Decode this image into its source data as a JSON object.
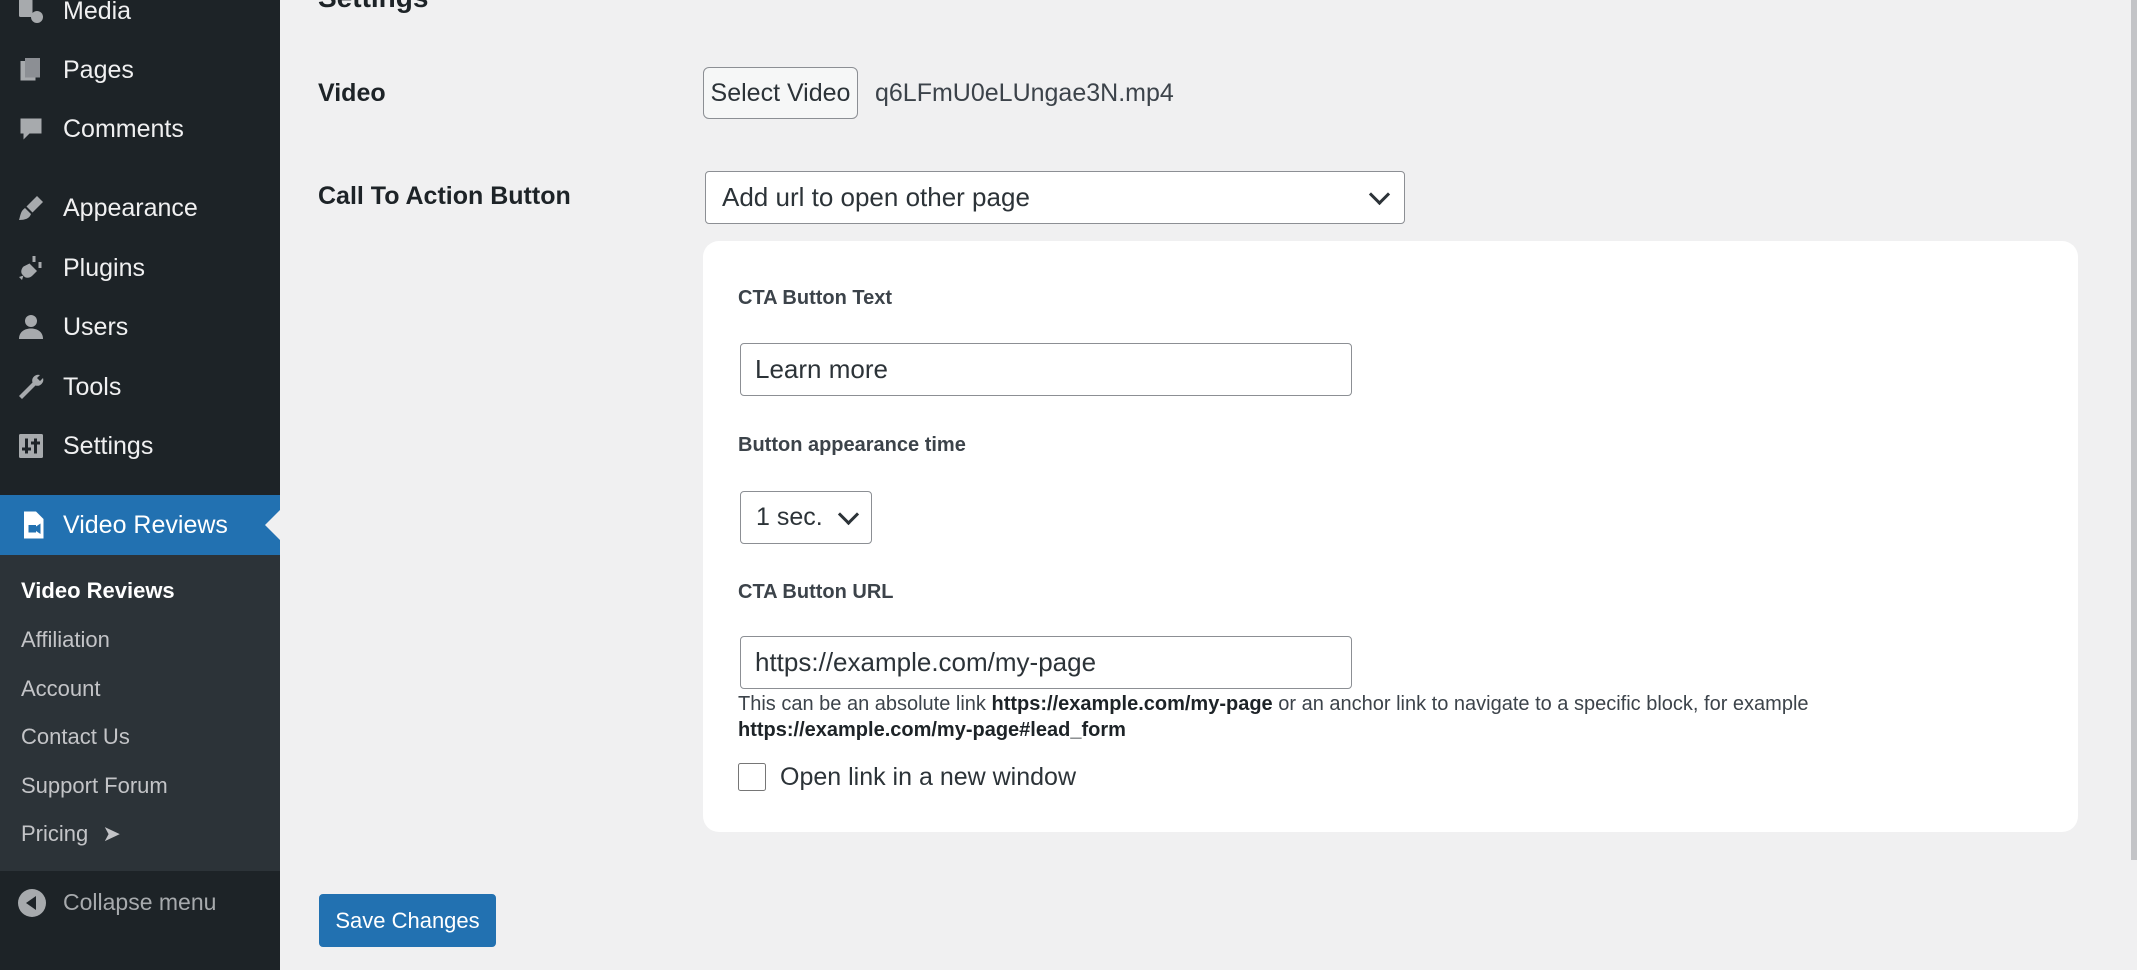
{
  "sidebar": {
    "items": [
      {
        "label": "Media",
        "icon": "media-icon"
      },
      {
        "label": "Pages",
        "icon": "pages-icon"
      },
      {
        "label": "Comments",
        "icon": "comments-icon"
      },
      {
        "label": "Appearance",
        "icon": "appearance-icon"
      },
      {
        "label": "Plugins",
        "icon": "plugins-icon"
      },
      {
        "label": "Users",
        "icon": "users-icon"
      },
      {
        "label": "Tools",
        "icon": "tools-icon"
      },
      {
        "label": "Settings",
        "icon": "settings-icon"
      }
    ],
    "active": {
      "label": "Video Reviews",
      "icon": "video-file-icon"
    },
    "submenu": [
      {
        "label": "Video Reviews"
      },
      {
        "label": "Affiliation"
      },
      {
        "label": "Account"
      },
      {
        "label": "Contact Us"
      },
      {
        "label": "Support Forum"
      },
      {
        "label": "Pricing",
        "suffix": "➤"
      }
    ],
    "collapse_label": "Collapse menu"
  },
  "main": {
    "heading": "Settings",
    "video": {
      "label": "Video",
      "button": "Select Video",
      "filename": "q6LFmU0eLUngae3N.mp4"
    },
    "cta": {
      "label": "Call To Action Button",
      "selected": "Add url to open other page",
      "panel": {
        "text_label": "CTA Button Text",
        "text_value": "Learn more",
        "time_label": "Button appearance time",
        "time_value": "1 sec.",
        "url_label": "CTA Button URL",
        "url_value": "https://example.com/my-page",
        "help_part1": "This can be an absolute link ",
        "help_link1": "https://example.com/my-page",
        "help_part2": " or an anchor link to navigate to a specific block, for example ",
        "help_link2": "https://example.com/my-page#lead_form",
        "new_window_label": "Open link in a new window",
        "new_window_checked": false
      }
    },
    "save_label": "Save Changes"
  },
  "colors": {
    "sidebar_bg": "#1d2327",
    "submenu_bg": "#2c3338",
    "accent": "#2271b1",
    "page_bg": "#f0f0f1"
  }
}
